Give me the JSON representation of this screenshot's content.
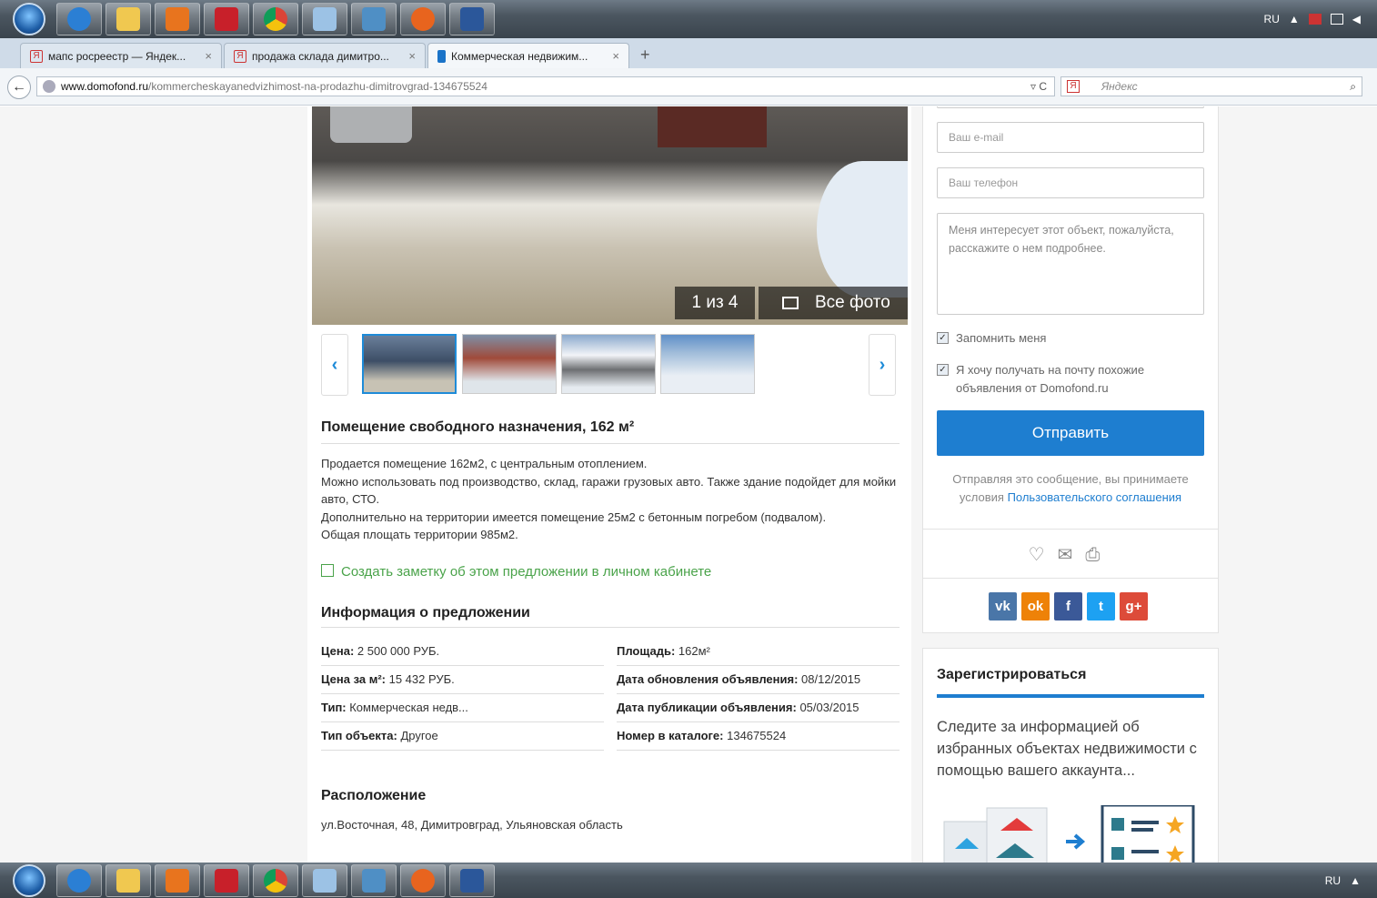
{
  "os": {
    "tray": {
      "lang": "RU"
    },
    "bottom_tray": {
      "lang": "RU"
    }
  },
  "tabs": [
    {
      "label": "мапс росреестр — Яндек...",
      "icon": "yandex-icon"
    },
    {
      "label": "продажа склада димитро...",
      "icon": "yandex-icon"
    },
    {
      "label": "Коммерческая недвижим...",
      "icon": "domofond-icon",
      "active": true
    }
  ],
  "address": {
    "host": "www.domofond.ru",
    "path": "/kommercheskayanedvizhimost-na-prodazhu-dimitrovgrad-134675524",
    "search_placeholder": "Яндекс"
  },
  "gallery": {
    "counter": "1 из 4",
    "all_photos": "Все фото"
  },
  "listing": {
    "title": "Помещение свободного назначения, 162 м²",
    "description": [
      "Продается помещение 162м2, с центральным отоплением.",
      "Можно использовать под производство, склад, гаражи грузовых авто. Также здание подойдет для мойки авто, СТО.",
      "Дополнительно на территории имеется помещение 25м2 с бетонным погребом (подвалом).",
      "Общая площать территории 985м2."
    ],
    "note_link": "Создать заметку об этом предложении в личном кабинете",
    "info_heading": "Информация о предложении",
    "info": [
      {
        "k": "Цена:",
        "v": " 2 500 000 РУБ."
      },
      {
        "k": "Площадь:",
        "v": " 162м²"
      },
      {
        "k": "Цена за м²:",
        "v": " 15 432 РУБ."
      },
      {
        "k": "Дата обновления объявления:",
        "v": " 08/12/2015"
      },
      {
        "k": "Тип:",
        "v": " Коммерческая недв..."
      },
      {
        "k": "Дата публикации объявления:",
        "v": " 05/03/2015"
      },
      {
        "k": "Тип объекта:",
        "v": " Другое"
      },
      {
        "k": "Номер в каталоге:",
        "v": " 134675524"
      }
    ],
    "location_heading": "Расположение",
    "address": "ул.Восточная, 48, Димитровград, Ульяновская область"
  },
  "contact_form": {
    "email_placeholder": "Ваш e-mail",
    "phone_placeholder": "Ваш телефон",
    "message": "Меня интересует этот объект, пожалуйста, расскажите о нем подробнее.",
    "remember_me": "Запомнить меня",
    "subscribe": "Я хочу получать на почту похожие объявления от Domofond.ru",
    "send": "Отправить",
    "terms_prefix": "Отправляя это сообщение, вы принимаете условия ",
    "terms_link": "Пользовательского соглашения"
  },
  "social": [
    {
      "label": "vk",
      "color": "#4a76a8"
    },
    {
      "label": "ok",
      "color": "#ee8208"
    },
    {
      "label": "f",
      "color": "#3b5998"
    },
    {
      "label": "t",
      "color": "#1da1f2"
    },
    {
      "label": "g+",
      "color": "#dd4b39"
    }
  ],
  "register": {
    "heading": "Зарегистрироваться",
    "text": "Следите за информацией об избранных объектах недвижимости с помощью вашего аккаунта..."
  },
  "colors": {
    "accent": "#1e7ed0",
    "link_green": "#4aa34a"
  }
}
